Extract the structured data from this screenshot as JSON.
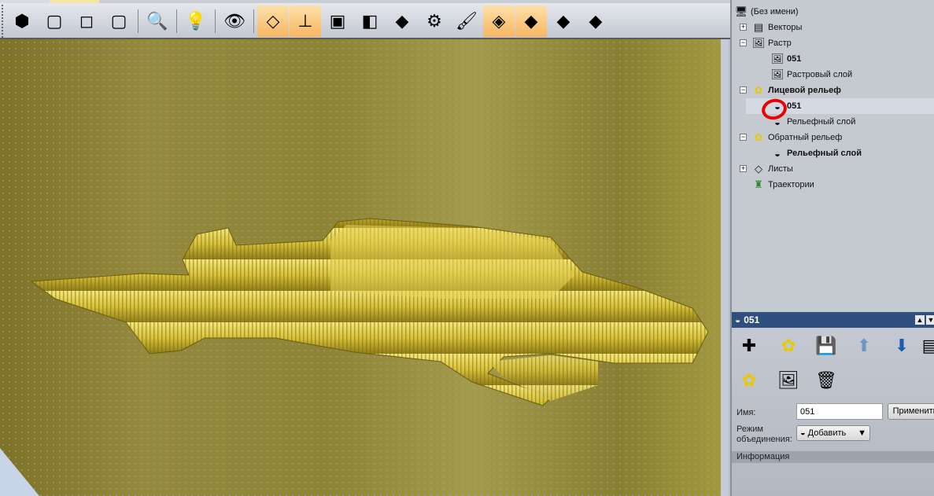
{
  "toolbar": {
    "items": [
      {
        "name": "view-iso-icon",
        "glyph": "⬢",
        "active": false
      },
      {
        "name": "view-wireframe-1-icon",
        "glyph": "▢",
        "active": false
      },
      {
        "name": "view-box-icon",
        "glyph": "◻",
        "active": false
      },
      {
        "name": "view-wireframe-2-icon",
        "glyph": "▢",
        "active": false
      },
      {
        "name": "zoom-icon",
        "glyph": "🔍",
        "active": false
      },
      {
        "name": "light-bulb-icon",
        "glyph": "💡",
        "active": false
      },
      {
        "name": "eye-icon",
        "glyph": "👁",
        "active": false
      },
      {
        "name": "plane-icon",
        "glyph": "◇",
        "active": true
      },
      {
        "name": "axes-icon",
        "glyph": "⊥",
        "active": true
      },
      {
        "name": "box-open-icon",
        "glyph": "▣",
        "active": false
      },
      {
        "name": "roll-icon",
        "glyph": "◧",
        "active": false
      },
      {
        "name": "relief-plane-icon",
        "glyph": "◆",
        "active": false
      },
      {
        "name": "tool-icon",
        "glyph": "⚙",
        "active": false
      },
      {
        "name": "paint-brush-icon",
        "glyph": "🖌",
        "active": false
      },
      {
        "name": "vectors-layer-icon",
        "glyph": "◈",
        "active": true
      },
      {
        "name": "layers-icon",
        "glyph": "◆",
        "active": true
      },
      {
        "name": "red-layers-icon",
        "glyph": "◆",
        "active": false
      },
      {
        "name": "heatmap-icon",
        "glyph": "◆",
        "active": false
      }
    ]
  },
  "tree": {
    "root": "(Без имени)",
    "vectors": "Векторы",
    "raster": "Растр",
    "raster_051": "051",
    "raster_layer": "Растровый слой",
    "front_relief": "Лицевой рельеф",
    "front_051": "051",
    "front_relief_layer": "Рельефный слой",
    "back_relief": "Обратный рельеф",
    "back_relief_layer": "Рельефный слой",
    "sheets": "Листы",
    "toolpaths": "Траектории"
  },
  "props": {
    "title": "051",
    "name_label": "Имя:",
    "name_value": "051",
    "apply_label": "Применить",
    "mode_label_1": "Режим",
    "mode_label_2": "объединения:",
    "mode_value": "Добавить",
    "info_label": "Информация"
  }
}
